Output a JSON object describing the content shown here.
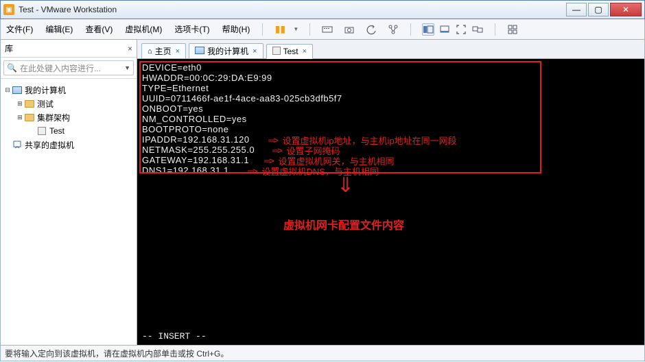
{
  "window": {
    "title": "Test - VMware Workstation",
    "controls": {
      "min": "—",
      "max": "▢",
      "close": "✕"
    }
  },
  "menu": {
    "file": "文件(F)",
    "edit": "编辑(E)",
    "view": "查看(V)",
    "vm": "虚拟机(M)",
    "tabs": "选项卡(T)",
    "help": "帮助(H)"
  },
  "library": {
    "label": "库",
    "search_placeholder": "在此处键入内容进行...",
    "tree": {
      "root": "我的计算机",
      "folder1": "测试",
      "folder2": "集群架构",
      "vm": "Test",
      "shared": "共享的虚拟机"
    }
  },
  "tabs": {
    "home": "主页",
    "mycomputer": "我的计算机",
    "test": "Test"
  },
  "terminal": {
    "lines": [
      "DEVICE=eth0",
      "HWADDR=00:0C:29:DA:E9:99",
      "TYPE=Ethernet",
      "UUID=0711466f-ae1f-4ace-aa83-025cb3dfb5f7",
      "ONBOOT=yes",
      "NM_CONTROLLED=yes",
      "BOOTPROTO=none",
      "IPADDR=192.168.31.120",
      "NETMASK=255.255.255.0",
      "GATEWAY=192.168.31.1",
      "DNS1=192.168.31.1"
    ],
    "mode": "-- INSERT --"
  },
  "annotations": {
    "ipaddr": "设置虚拟机ip地址，与主机ip地址在同一网段",
    "netmask": "设置子网掩码",
    "gateway": "设置虚拟机网关，与主机相同",
    "dns": "设置虚拟机DNS，与主机相同",
    "caption": "虚拟机网卡配置文件内容"
  },
  "status": "要将输入定向到该虚拟机，请在虚拟机内部单击或按 Ctrl+G。",
  "glyphs": {
    "close_x": "×",
    "arrow": "⇒"
  }
}
